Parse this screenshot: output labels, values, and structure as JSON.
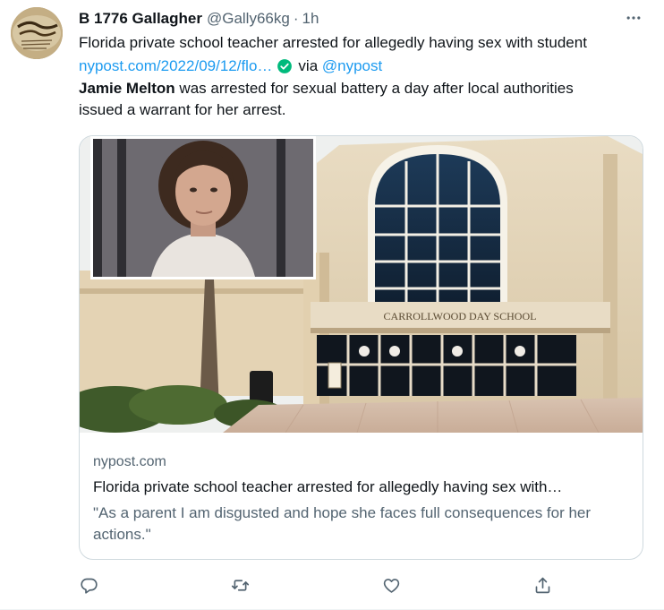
{
  "tweet": {
    "display_name": "B 1776 Gallagher",
    "handle": "@Gally66kg",
    "separator": "·",
    "time": "1h",
    "line1": "Florida private school teacher arrested for allegedly having sex with student",
    "link": "nypost.com/2022/09/12/flo…",
    "via_text": "via",
    "via_handle": "@nypost",
    "quote_name": "Jamie Melton",
    "quote_rest": " was arrested for sexual battery a day after local authorities",
    "quote_line2": "issued a warrant for her arrest."
  },
  "card": {
    "sign_text": "CARROLLWOOD DAY SCHOOL",
    "domain": "nypost.com",
    "title": "Florida private school teacher arrested for allegedly having sex with…",
    "description": "\"As a parent I am disgusted and hope she faces full consequences for her actions.\""
  },
  "icons": {
    "avatar": "constitution-avatar",
    "more": "more-icon",
    "verified": "verified-badge-icon",
    "reply": "reply-icon",
    "retweet": "retweet-icon",
    "like": "heart-icon",
    "share": "share-icon"
  },
  "colors": {
    "link": "#1d9bf0",
    "secondary_text": "#536471",
    "verified_badge": "#00ba7c",
    "border": "#cfd9de"
  }
}
